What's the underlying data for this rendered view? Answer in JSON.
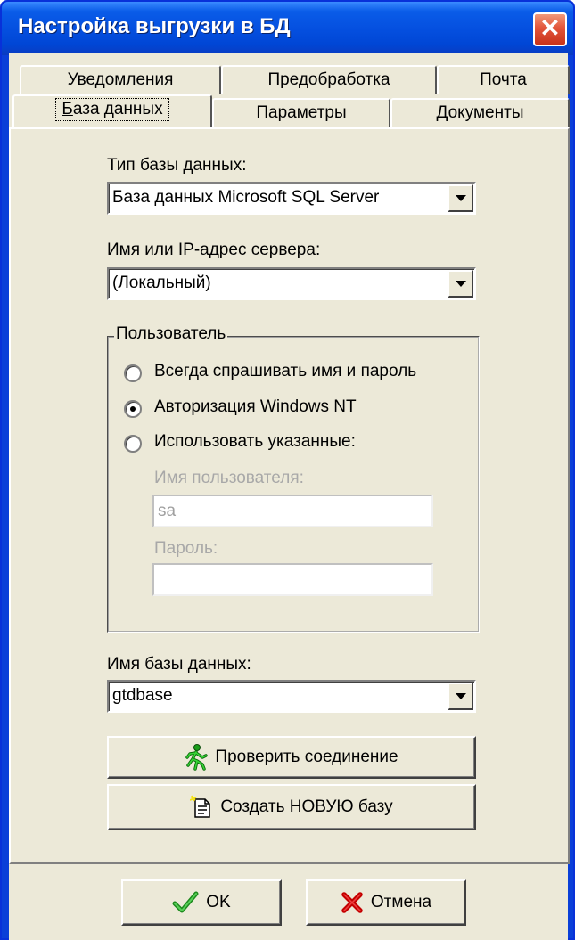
{
  "window": {
    "title": "Настройка выгрузки в БД",
    "close_glyph": "✕"
  },
  "tabs_row1": [
    {
      "label_pre": "",
      "label_u": "У",
      "label_post": "ведомления"
    },
    {
      "label_pre": "Пред",
      "label_u": "о",
      "label_post": "бработка"
    },
    {
      "label_pre": "Почта",
      "label_u": "",
      "label_post": ""
    }
  ],
  "tabs_row2": [
    {
      "label_pre": "",
      "label_u": "Б",
      "label_post": "аза данных",
      "active": true
    },
    {
      "label_pre": "",
      "label_u": "П",
      "label_post": "араметры"
    },
    {
      "label_pre": "",
      "label_u": "Д",
      "label_post": "окументы"
    }
  ],
  "db_type": {
    "label": "Тип базы данных:",
    "value": "База данных Microsoft SQL Server"
  },
  "server": {
    "label": "Имя или IP-адрес сервера:",
    "value": "(Локальный)"
  },
  "user_group": {
    "title": "Пользователь",
    "options": [
      {
        "label": "Всегда спрашивать имя и пароль",
        "selected": false
      },
      {
        "label": "Авторизация Windows NT",
        "selected": true
      },
      {
        "label": "Использовать указанные:",
        "selected": false
      }
    ],
    "username_label": "Имя пользователя:",
    "username_value": "sa",
    "password_label": "Пароль:",
    "password_value": ""
  },
  "db_name": {
    "label": "Имя базы данных:",
    "value": "gtdbase"
  },
  "buttons": {
    "test_connection": "Проверить соединение",
    "create_db": "Создать НОВУЮ базу",
    "ok": "OK",
    "cancel": "Отмена"
  },
  "icons": {
    "test_connection": "running-man-icon",
    "create_db": "new-document-icon",
    "ok": "checkmark-icon",
    "cancel": "red-x-icon"
  }
}
